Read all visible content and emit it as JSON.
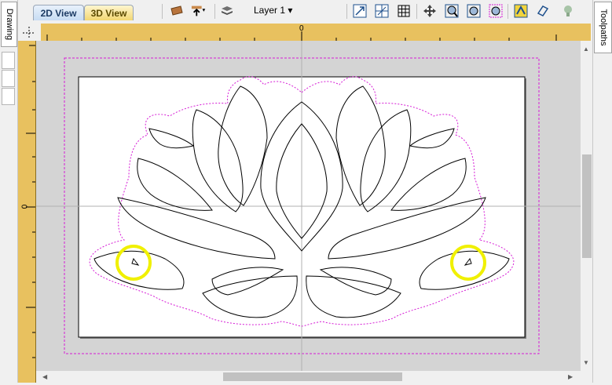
{
  "left_panel": {
    "drawing_tab_label": "Drawing"
  },
  "right_panel": {
    "toolpaths_tab_label": "Toolpaths"
  },
  "toolbar": {
    "tab_2d_label": "2D View",
    "tab_3d_label": "3D View",
    "layer_label": "Layer 1",
    "layer_dropdown_arrow": "▾"
  },
  "rulers": {
    "top_zero": "0",
    "left_zero": "0"
  },
  "colors": {
    "ruler": "#e8c15f",
    "canvas_bg": "#d4d4d4",
    "sheet": "#ffffff",
    "boundary_dash": "#d61cd6",
    "highlight": "#f0f000"
  }
}
